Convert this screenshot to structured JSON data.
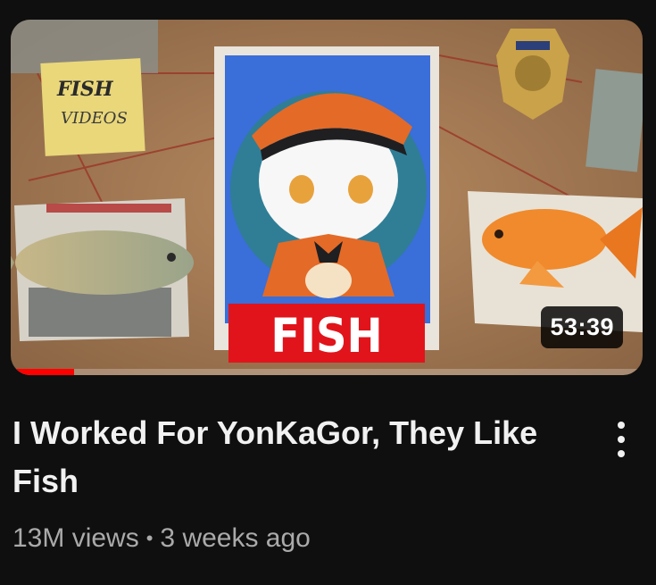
{
  "video": {
    "title": "I Worked For YonKaGor, They Like Fish",
    "views": "13M views",
    "separator": "•",
    "age": "3 weeks ago",
    "duration": "53:39",
    "watch_progress": 0.1
  },
  "thumbnail": {
    "banner_text": "FISH",
    "sticky_note_line1": "FISH",
    "sticky_note_line2": "VIDEOS",
    "colors": {
      "corkboard": "#a87d55",
      "banner": "#e1141b",
      "photo_bg": "#3a6ed8",
      "cap": "#e46a27",
      "goldfish": "#f08a2c"
    }
  },
  "icons": {
    "menu": "more-vert-icon"
  }
}
